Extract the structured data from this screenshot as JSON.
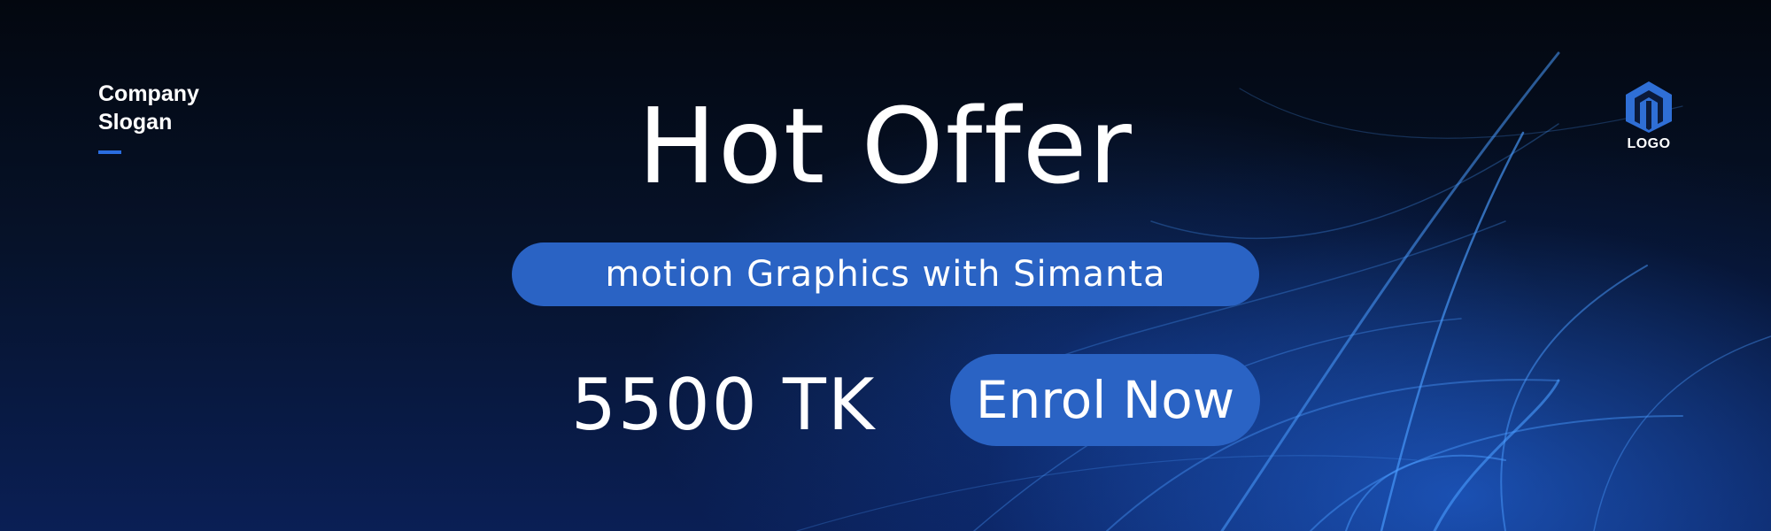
{
  "brand": {
    "slogan_line1": "Company",
    "slogan_line2": "Slogan",
    "logo_text": "LOGO"
  },
  "offer": {
    "headline": "Hot Offer",
    "course": "motion Graphics with Simanta",
    "price": "5500 TK",
    "cta_label": "Enrol Now"
  },
  "colors": {
    "accent": "#2a63c4",
    "background": "#061229",
    "text": "#ffffff"
  },
  "icons": {
    "logo": "hexagon-logo-icon"
  }
}
